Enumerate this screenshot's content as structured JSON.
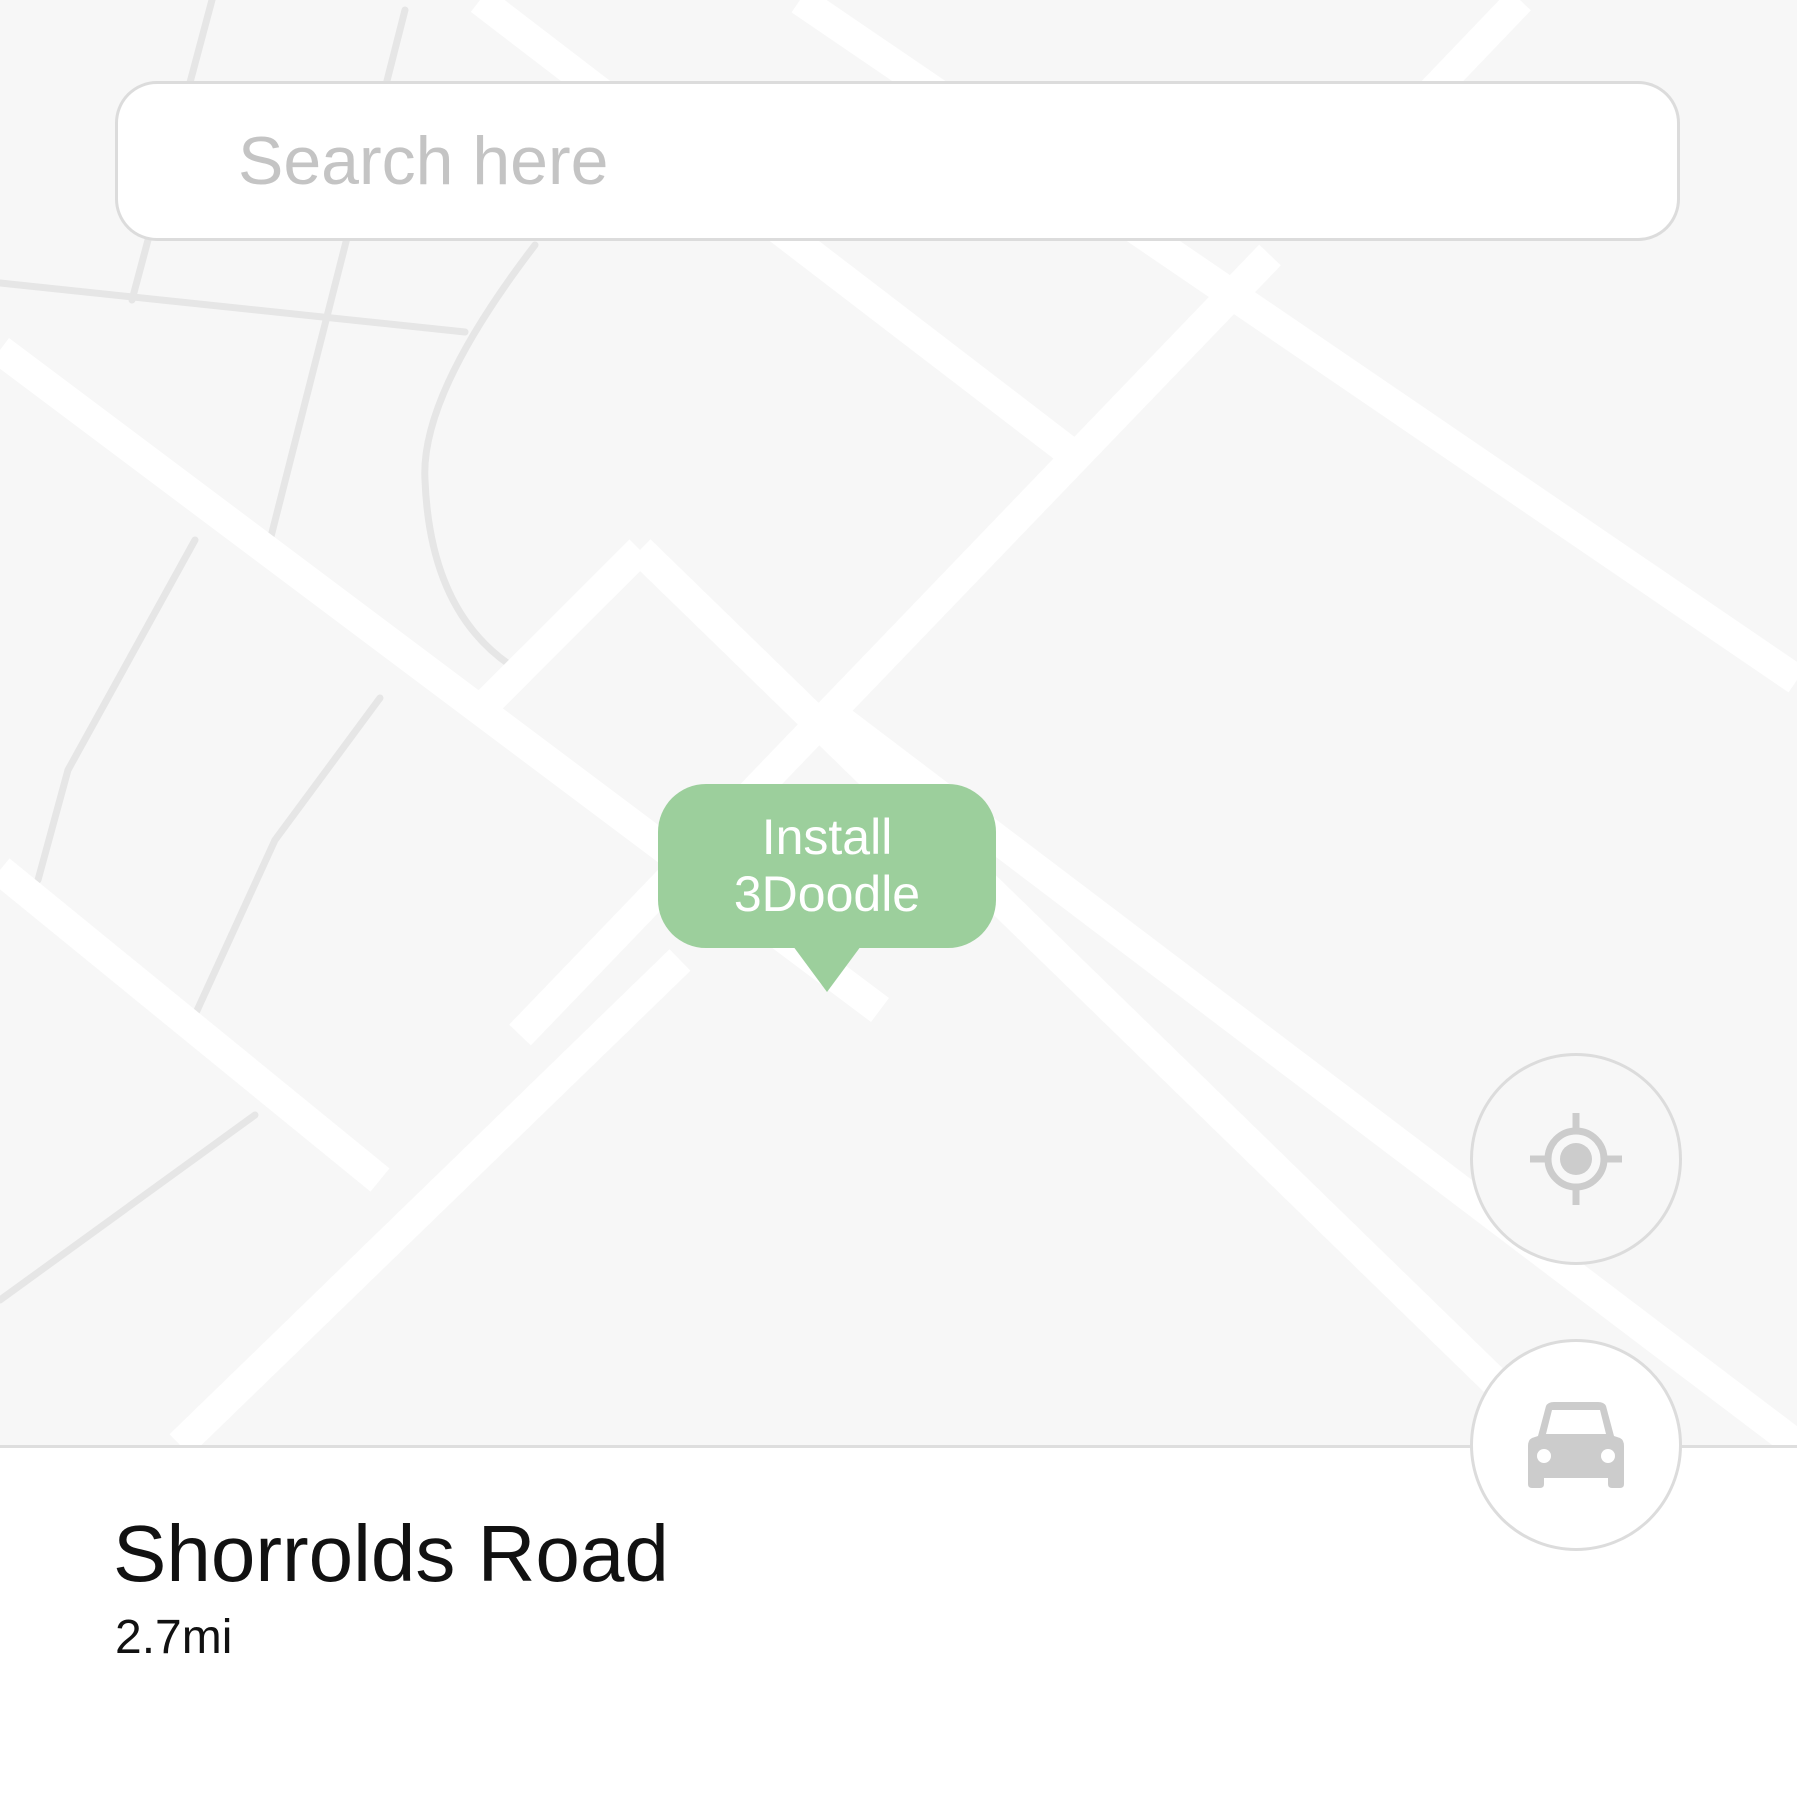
{
  "search": {
    "placeholder": "Search here",
    "value": ""
  },
  "marker": {
    "line1": "Install",
    "line2": "3Doodle",
    "color": "#9ccf9c"
  },
  "place": {
    "name": "Shorrolds Road",
    "distance": "2.7mi"
  },
  "controls": {
    "locate_icon": "crosshair-icon",
    "drive_icon": "car-icon"
  },
  "colors": {
    "map_background": "#f7f7f7",
    "road": "#ffffff",
    "minor_road": "#e6e6e6",
    "icon": "#cccccc"
  }
}
